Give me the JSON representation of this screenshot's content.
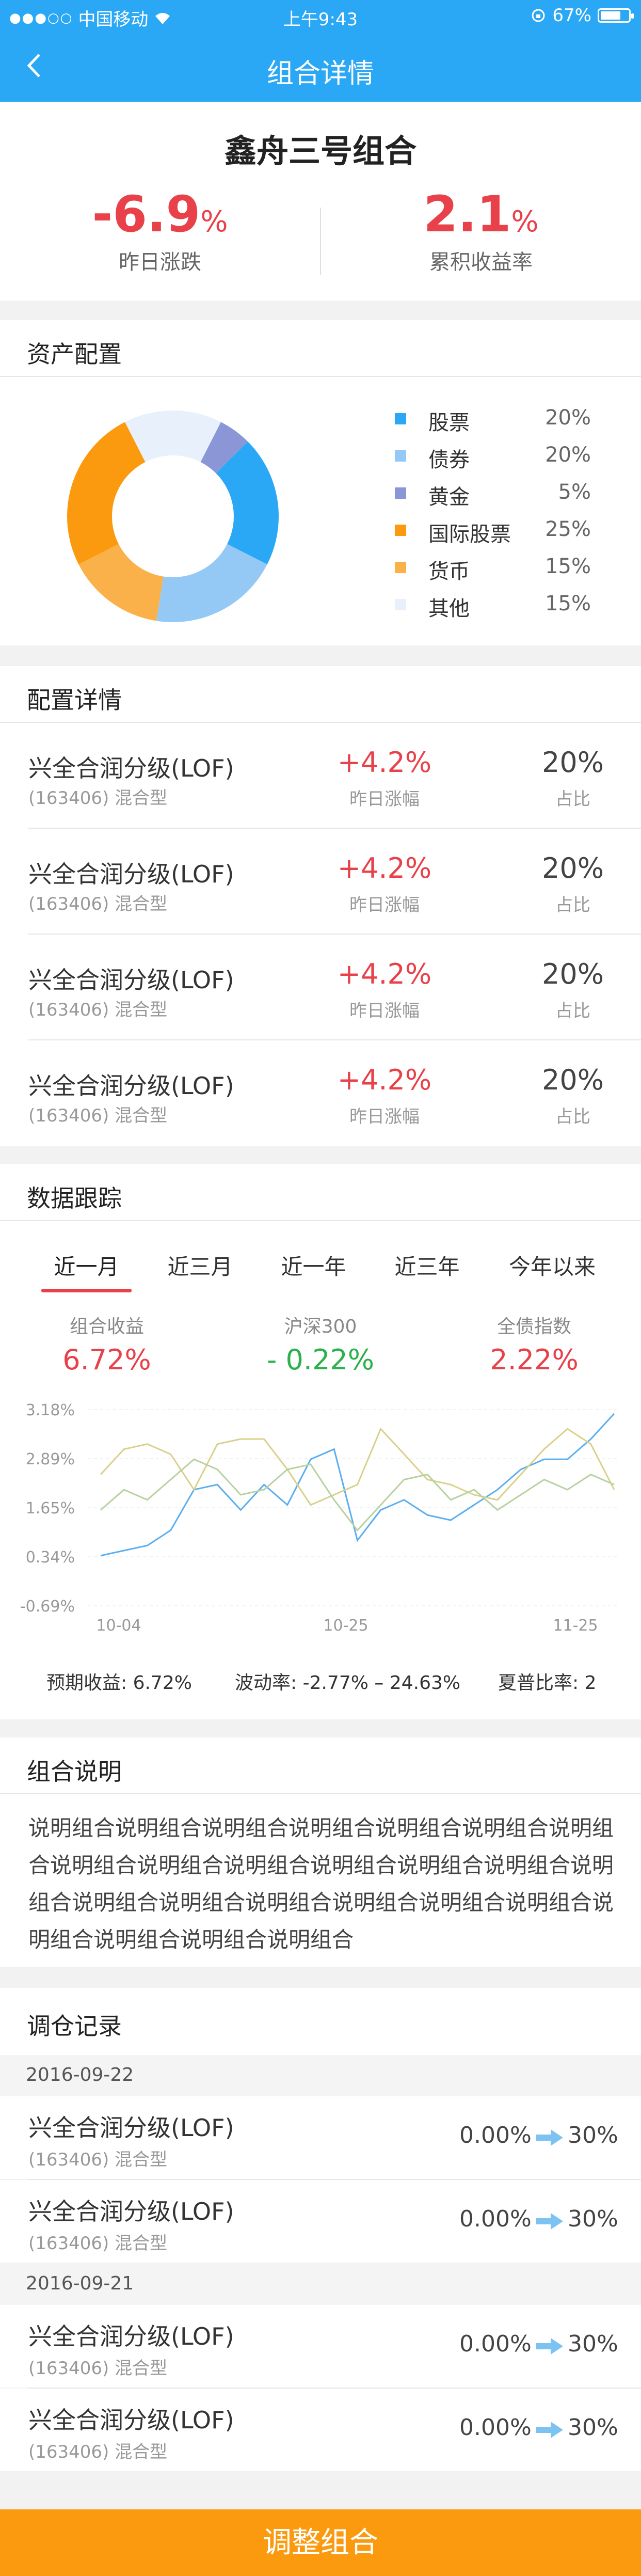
{
  "status_bar": {
    "signal": "●●●○○",
    "carrier": "中国移动",
    "time": "上午9:43",
    "battery": "67%"
  },
  "navbar": {
    "title": "组合详情"
  },
  "header": {
    "name": "鑫舟三号组合",
    "yesterday": {
      "value": "-6.9",
      "unit": "%",
      "label": "昨日涨跌"
    },
    "cumulative": {
      "value": "2.1",
      "unit": "%",
      "label": "累积收益率"
    }
  },
  "allocation": {
    "title": "资产配置",
    "items": [
      {
        "name": "股票",
        "pct": "20%",
        "color": "#2aa8f5"
      },
      {
        "name": "债券",
        "pct": "20%",
        "color": "#94c9f6"
      },
      {
        "name": "黄金",
        "pct": "5%",
        "color": "#8a96d6"
      },
      {
        "name": "国际股票",
        "pct": "25%",
        "color": "#fb9a0f"
      },
      {
        "name": "货币",
        "pct": "15%",
        "color": "#fbb14a"
      },
      {
        "name": "其他",
        "pct": "15%",
        "color": "#e8f1fb"
      }
    ]
  },
  "config": {
    "title": "配置详情",
    "rows": [
      {
        "name": "兴全合润分级(LOF)",
        "code": "(163406) 混合型",
        "change": "+4.2%",
        "change_label": "昨日涨幅",
        "ratio": "20%",
        "ratio_label": "占比"
      },
      {
        "name": "兴全合润分级(LOF)",
        "code": "(163406) 混合型",
        "change": "+4.2%",
        "change_label": "昨日涨幅",
        "ratio": "20%",
        "ratio_label": "占比"
      },
      {
        "name": "兴全合润分级(LOF)",
        "code": "(163406) 混合型",
        "change": "+4.2%",
        "change_label": "昨日涨幅",
        "ratio": "20%",
        "ratio_label": "占比"
      },
      {
        "name": "兴全合润分级(LOF)",
        "code": "(163406) 混合型",
        "change": "+4.2%",
        "change_label": "昨日涨幅",
        "ratio": "20%",
        "ratio_label": "占比"
      }
    ]
  },
  "tracking": {
    "title": "数据跟踪",
    "tabs": [
      "近一月",
      "近三月",
      "近一年",
      "近三年",
      "今年以来"
    ],
    "active_tab": 0,
    "metrics": [
      {
        "label": "组合收益",
        "value": "6.72%",
        "color": "#e9414a"
      },
      {
        "label": "沪深300",
        "value": "- 0.22%",
        "color": "#2bb24c"
      },
      {
        "label": "全债指数",
        "value": "2.22%",
        "color": "#e9414a"
      }
    ],
    "stats": {
      "expected": "预期收益: 6.72%",
      "volatility": "波动率: -2.77% – 24.63%",
      "sharpe": "夏普比率: 2"
    }
  },
  "chart_data": {
    "type": "line",
    "y_ticks": [
      "3.18%",
      "2.89%",
      "1.65%",
      "0.34%",
      "-0.69%"
    ],
    "x_ticks": [
      "10-04",
      "10-25",
      "11-25"
    ],
    "ylim": [
      -0.69,
      3.18
    ],
    "series": [
      {
        "color": "#5aaef0",
        "values": [
          0.3,
          0.4,
          0.5,
          0.8,
          1.6,
          1.7,
          1.2,
          1.7,
          1.3,
          2.2,
          2.4,
          0.6,
          1.2,
          1.4,
          1.1,
          1.0,
          1.3,
          1.6,
          2.0,
          2.2,
          2.2,
          2.6,
          3.1
        ]
      },
      {
        "color": "#d9d18a",
        "values": [
          1.9,
          2.4,
          2.5,
          2.3,
          1.6,
          2.5,
          2.6,
          2.6,
          2.0,
          1.3,
          1.5,
          1.7,
          2.8,
          2.3,
          1.8,
          1.7,
          1.5,
          1.4,
          1.9,
          2.4,
          2.8,
          2.5,
          1.6
        ]
      },
      {
        "color": "#b8d1a0",
        "values": [
          1.2,
          1.6,
          1.4,
          1.8,
          2.2,
          2.0,
          1.5,
          1.6,
          2.0,
          2.1,
          1.4,
          0.8,
          1.3,
          1.8,
          1.9,
          1.4,
          1.6,
          1.2,
          1.5,
          1.8,
          1.6,
          1.9,
          1.7
        ]
      }
    ]
  },
  "description": {
    "title": "组合说明",
    "text": "说明组合说明组合说明组合说明组合说明组合说明组合说明组合说明组合说明组合说明组合说明组合说明组合说明组合说明组合说明组合说明组合说明组合说明组合说明组合说明组合说明组合说明组合说明组合说明组合"
  },
  "records": {
    "title": "调仓记录",
    "groups": [
      {
        "date": "2016-09-22",
        "rows": [
          {
            "name": "兴全合润分级(LOF)",
            "code": "(163406) 混合型",
            "from": "0.00%",
            "to": "30%"
          },
          {
            "name": "兴全合润分级(LOF)",
            "code": "(163406) 混合型",
            "from": "0.00%",
            "to": "30%"
          }
        ]
      },
      {
        "date": "2016-09-21",
        "rows": [
          {
            "name": "兴全合润分级(LOF)",
            "code": "(163406) 混合型",
            "from": "0.00%",
            "to": "30%"
          },
          {
            "name": "兴全合润分级(LOF)",
            "code": "(163406) 混合型",
            "from": "0.00%",
            "to": "30%"
          }
        ]
      }
    ]
  },
  "cta": {
    "label": "调整组合"
  }
}
